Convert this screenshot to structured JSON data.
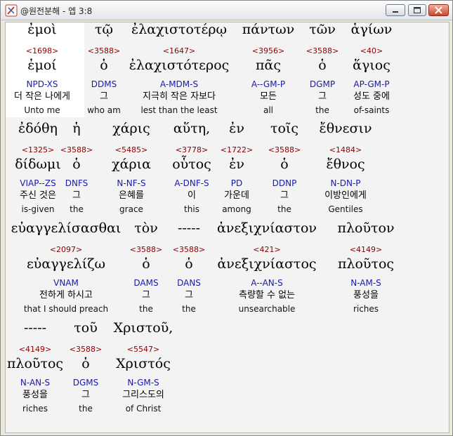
{
  "window": {
    "title": "@원전분해 - 엡 3:8",
    "buttons": {
      "minimize": "minimize",
      "maximize": "maximize",
      "close": "close"
    }
  },
  "rows": [
    [
      {
        "greek": "ἐμοὶ",
        "strong": "<1698>",
        "lemma": "ἐμοί",
        "morph": "NPD-XS",
        "korean": "더 작은 나에게",
        "english": "Unto me"
      },
      {
        "greek": "τῷ",
        "strong": "<3588>",
        "lemma": "ὁ",
        "morph": "DDMS",
        "korean": "그",
        "english": "who am"
      },
      {
        "greek": "ἐλαχιστοτέρῳ",
        "strong": "<1647>",
        "lemma": "ἐλαχιστότερος",
        "morph": "A-MDM-S",
        "korean": "지극히 작은 자보다",
        "english": "lest than the least"
      },
      {
        "greek": "πάντων",
        "strong": "<3956>",
        "lemma": "πᾶς",
        "morph": "A--GM-P",
        "korean": "모든",
        "english": "all"
      },
      {
        "greek": "τῶν",
        "strong": "<3588>",
        "lemma": "ὁ",
        "morph": "DGMP",
        "korean": "그",
        "english": "the"
      },
      {
        "greek": "ἁγίων",
        "strong": "<40>",
        "lemma": "ἅγιος",
        "morph": "AP-GM-P",
        "korean": "성도 중에",
        "english": "of-saints"
      }
    ],
    [
      {
        "greek": "ἐδόθη",
        "strong": "<1325>",
        "lemma": "δίδωμι",
        "morph": "VIAP--ZS",
        "korean": "주신 것은",
        "english": "is-given"
      },
      {
        "greek": "ἡ",
        "strong": "<3588>",
        "lemma": "ὁ",
        "morph": "DNFS",
        "korean": "그",
        "english": "the"
      },
      {
        "greek": "χάρις",
        "strong": "<5485>",
        "lemma": "χάρια",
        "morph": "N-NF-S",
        "korean": "은혜를",
        "english": "grace"
      },
      {
        "greek": "αὕτη,",
        "strong": "<3778>",
        "lemma": "οὗτος",
        "morph": "A-DNF-S",
        "korean": "이",
        "english": "this"
      },
      {
        "greek": "ἐν",
        "strong": "<1722>",
        "lemma": "ἐν",
        "morph": "PD",
        "korean": "가운데",
        "english": "among"
      },
      {
        "greek": "τοῖς",
        "strong": "<3588>",
        "lemma": "ὁ",
        "morph": "DDNP",
        "korean": "그",
        "english": "the"
      },
      {
        "greek": "ἔθνεσιν",
        "strong": "<1484>",
        "lemma": "ἔθνος",
        "morph": "N-DN-P",
        "korean": "이방인에게",
        "english": "Gentiles"
      }
    ],
    [
      {
        "greek": "εὐαγγελίσασθαι",
        "strong": "<2097>",
        "lemma": "εὐαγγελίζω",
        "morph": "VNAM",
        "korean": "전하게 하시고",
        "english": "that I should preach"
      },
      {
        "greek": "τὸν",
        "strong": "<3588>",
        "lemma": "ὁ",
        "morph": "DAMS",
        "korean": "그",
        "english": "the"
      },
      {
        "greek": "-----",
        "strong": "<3588>",
        "lemma": "ὁ",
        "morph": "DANS",
        "korean": "그",
        "english": "the"
      },
      {
        "greek": "ἀνεξιχνίαστον",
        "strong": "<421>",
        "lemma": "ἀνεξιχνίαστος",
        "morph": "A--AN-S",
        "korean": "측량할 수 없는",
        "english": "unsearchable"
      },
      {
        "greek": "πλοῦτον",
        "strong": "<4149>",
        "lemma": "πλοῦτος",
        "morph": "N-AM-S",
        "korean": "풍성을",
        "english": "riches"
      }
    ],
    [
      {
        "greek": "-----",
        "strong": "<4149>",
        "lemma": "πλοῦτος",
        "morph": "N-AN-S",
        "korean": "풍성을",
        "english": "riches"
      },
      {
        "greek": "τοῦ",
        "strong": "<3588>",
        "lemma": "ὁ",
        "morph": "DGMS",
        "korean": "그",
        "english": "the"
      },
      {
        "greek": "Χριστοῦ,",
        "strong": "<5547>",
        "lemma": "Χριστός",
        "morph": "N-GM-S",
        "korean": "그리스도의",
        "english": "of Christ"
      }
    ]
  ]
}
